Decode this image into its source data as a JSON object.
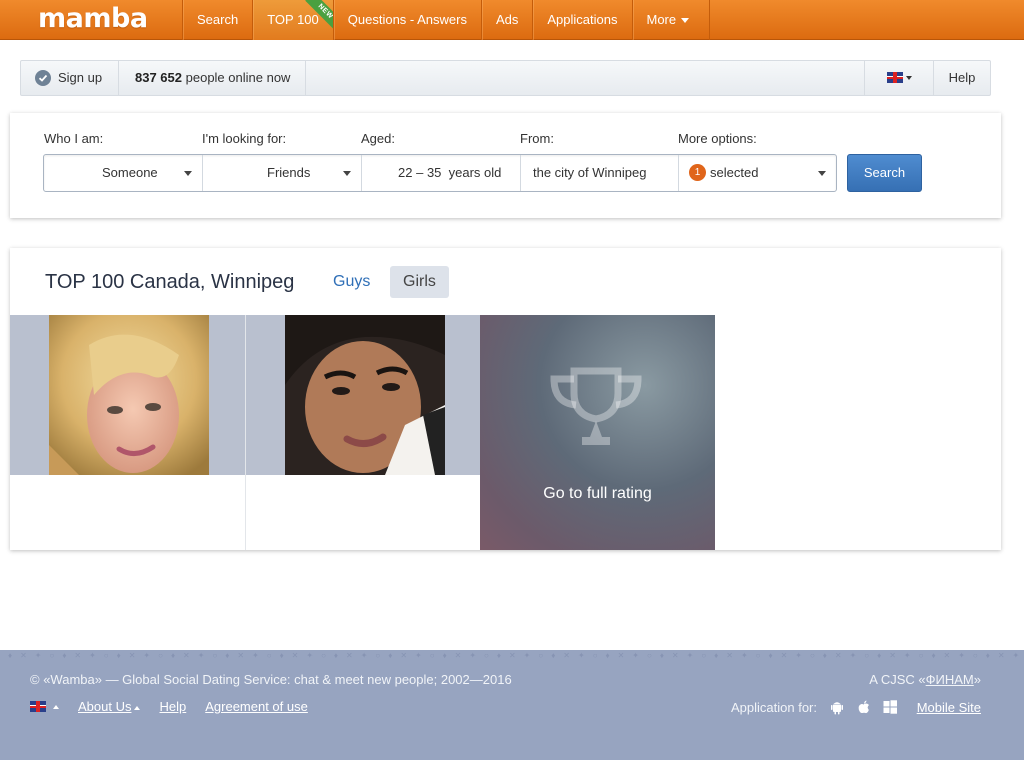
{
  "brand": {
    "logo_text": "mamba",
    "accent": "#e8781c"
  },
  "nav": {
    "items": [
      {
        "label": "Search"
      },
      {
        "label": "TOP 100",
        "ribbon": "NEW"
      },
      {
        "label": "Questions - Answers"
      },
      {
        "label": "Ads"
      },
      {
        "label": "Applications"
      },
      {
        "label": "More"
      }
    ]
  },
  "statusbar": {
    "signup_label": "Sign up",
    "online_count": "837 652",
    "online_suffix": "people online now",
    "help_label": "Help",
    "language_icon": "uk-flag-icon"
  },
  "search": {
    "labels": {
      "who": "Who I am:",
      "looking": "I'm looking for:",
      "aged": "Aged:",
      "from": "From:",
      "more": "More options:"
    },
    "who_value": "Someone",
    "looking_value": "Friends",
    "age_from": "22",
    "age_to": "35",
    "age_suffix": "years old",
    "from_value": "the city of Winnipeg",
    "options_count": "1",
    "options_value": "selected",
    "button_label": "Search"
  },
  "top100": {
    "title": "TOP 100 Canada, Winnipeg",
    "tabs": [
      {
        "label": "Guys"
      },
      {
        "label": "Girls",
        "active": true
      }
    ],
    "rating_label": "Go to full rating"
  },
  "footer": {
    "copyright": "© «Wamba» — Global Social Dating Service: chat & meet new people; 2002—2016",
    "company_prefix": "A CJSC «",
    "company_name": "ФИНАМ",
    "company_suffix": "»",
    "links": [
      {
        "label": "About Us"
      },
      {
        "label": "Help"
      },
      {
        "label": "Agreement of use"
      }
    ],
    "app_for": "Application for:",
    "mobile_site": "Mobile Site"
  }
}
